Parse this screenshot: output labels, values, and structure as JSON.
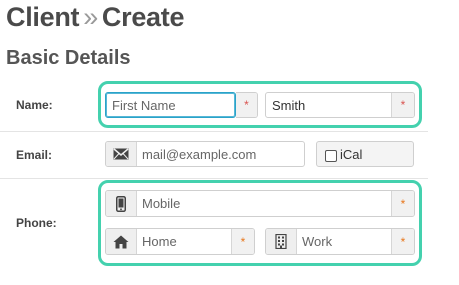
{
  "header": {
    "title_part1": "Client",
    "separator": "»",
    "title_part2": "Create"
  },
  "section": {
    "title": "Basic Details"
  },
  "name_row": {
    "label": "Name:",
    "first_name_placeholder": "First Name",
    "last_name_value": "Smith",
    "required_mark": "*"
  },
  "email_row": {
    "label": "Email:",
    "email_placeholder": "mail@example.com",
    "ical_label": "iCal",
    "icon": "envelope-icon"
  },
  "phone_row": {
    "label": "Phone:",
    "mobile_placeholder": "Mobile",
    "home_placeholder": "Home",
    "work_placeholder": "Work",
    "required_mark": "*",
    "icons": [
      "mobile-phone-icon",
      "home-icon",
      "building-icon"
    ]
  },
  "colors": {
    "highlight": "#44d1ae",
    "focus": "#2aa3c9",
    "required_red": "#d9534f",
    "required_orange": "#e8761a"
  }
}
